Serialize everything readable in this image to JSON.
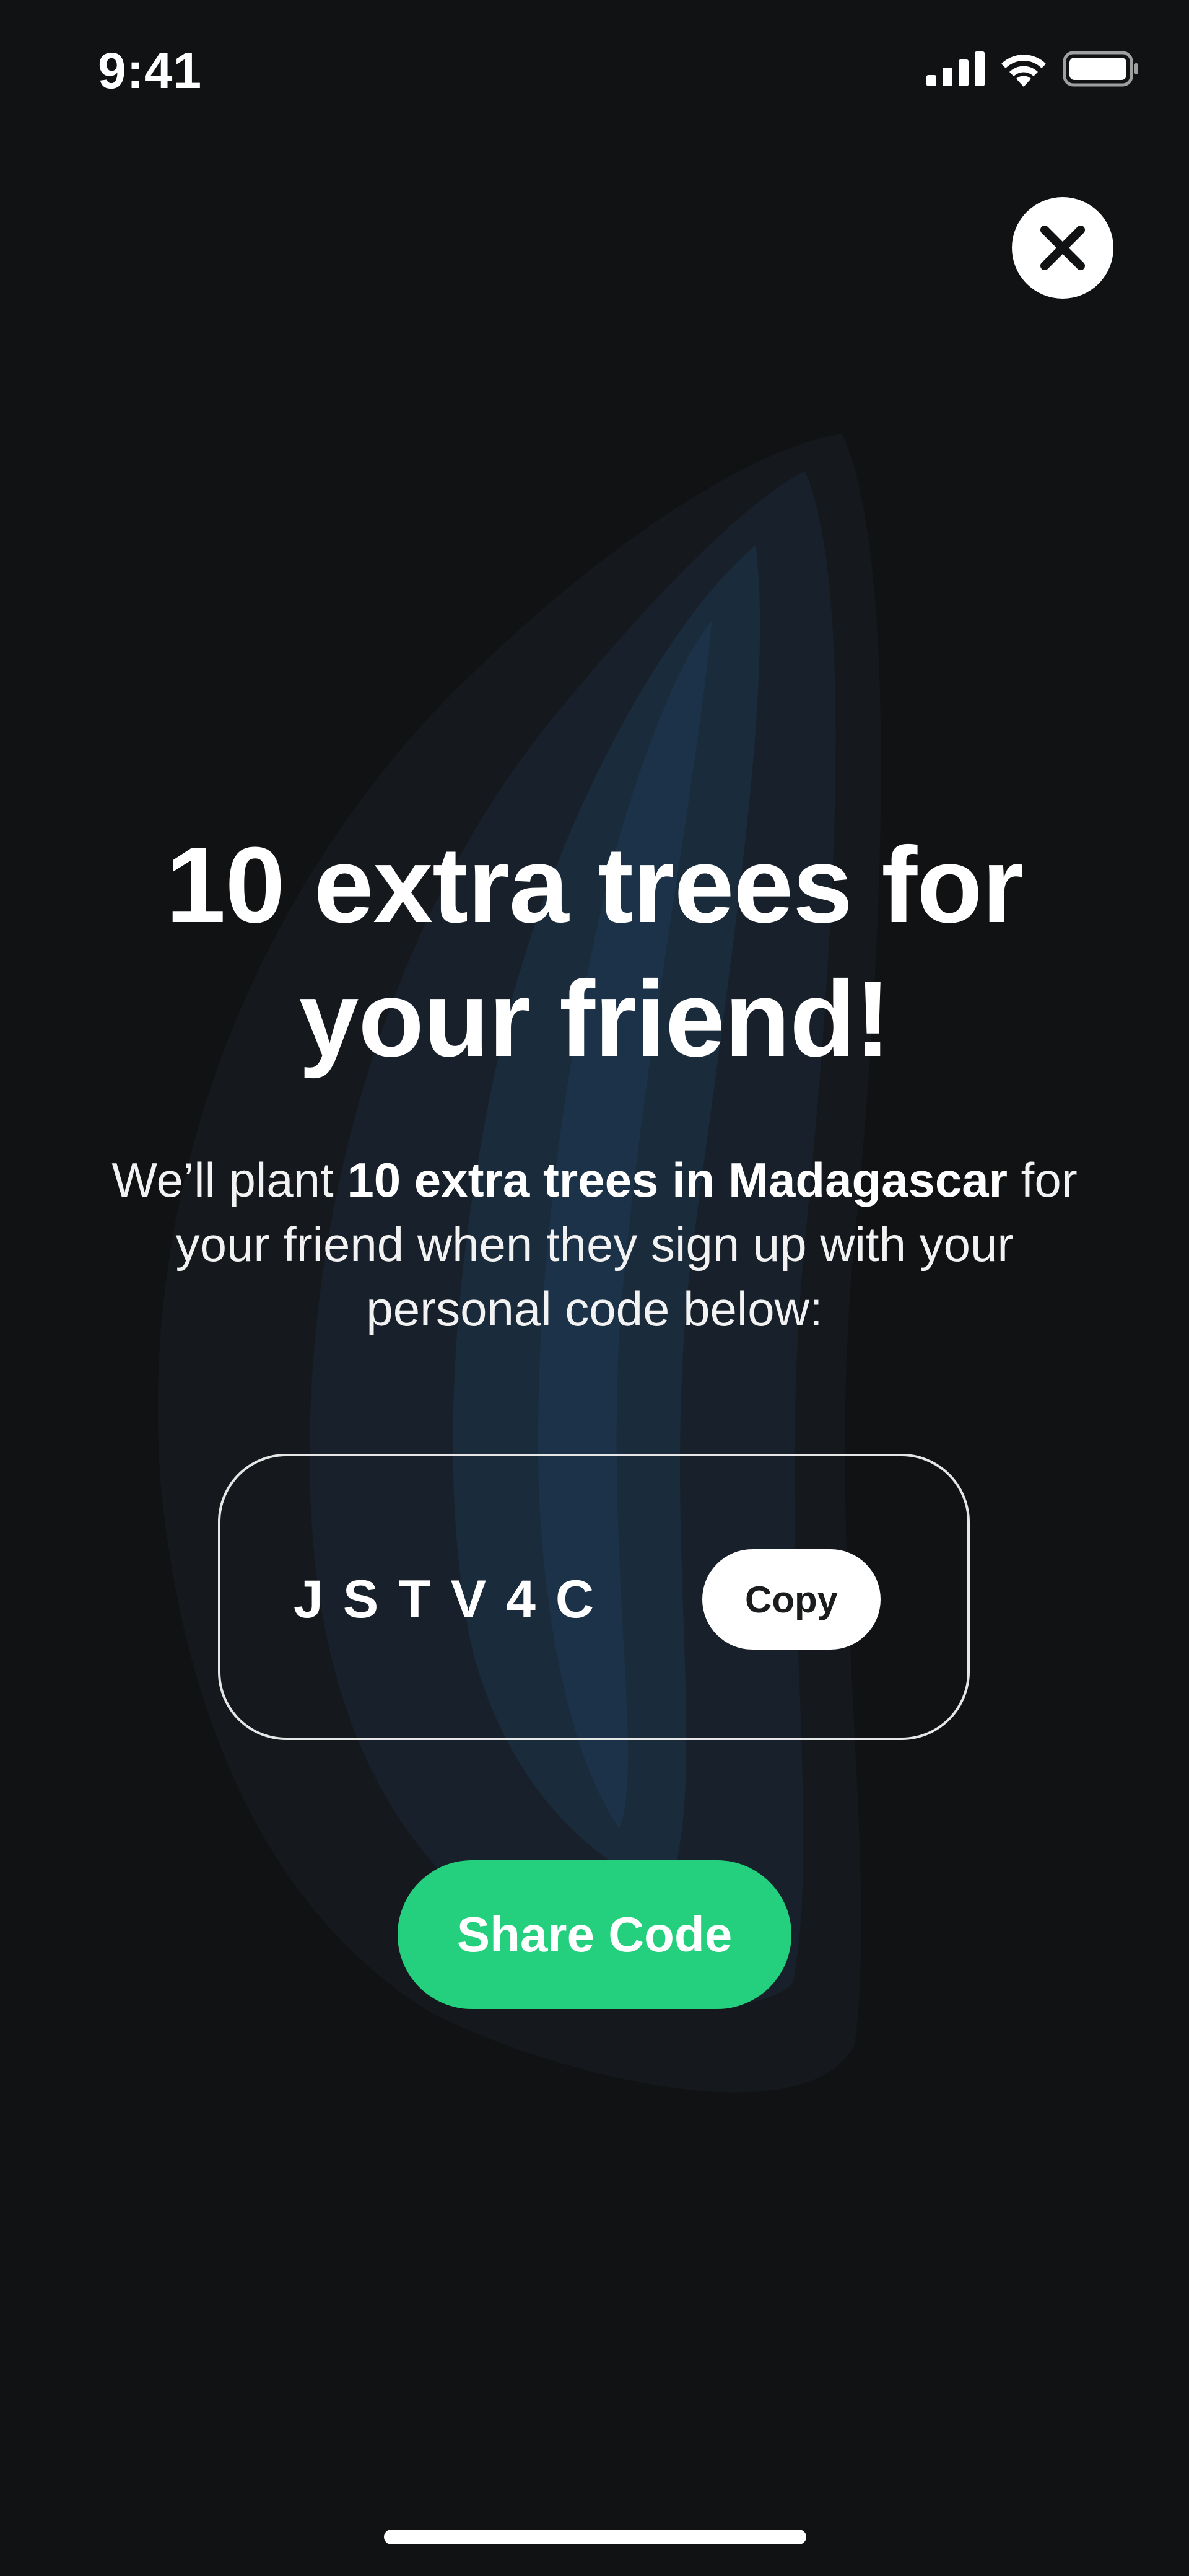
{
  "status_bar": {
    "time": "9:41",
    "icons": [
      "cellular-signal-icon",
      "wifi-icon",
      "battery-icon"
    ]
  },
  "close_button": {
    "icon": "close-icon"
  },
  "headline": {
    "line1": "10 extra trees for",
    "line2": "your friend!"
  },
  "description": {
    "line1_pre": "We’ll plant ",
    "line1_bold": "10 extra trees in Madagascar",
    "line1_post": " for",
    "line2": "your friend when they sign up with your",
    "line3": "personal code below:"
  },
  "referral": {
    "code": "JSTV4C",
    "copy_label": "Copy"
  },
  "share_button": {
    "label": "Share Code"
  },
  "colors": {
    "background": "#111213",
    "accent_green": "#24cf7d",
    "leaf_blue": "#1a2b3b",
    "text": "#ffffff"
  }
}
